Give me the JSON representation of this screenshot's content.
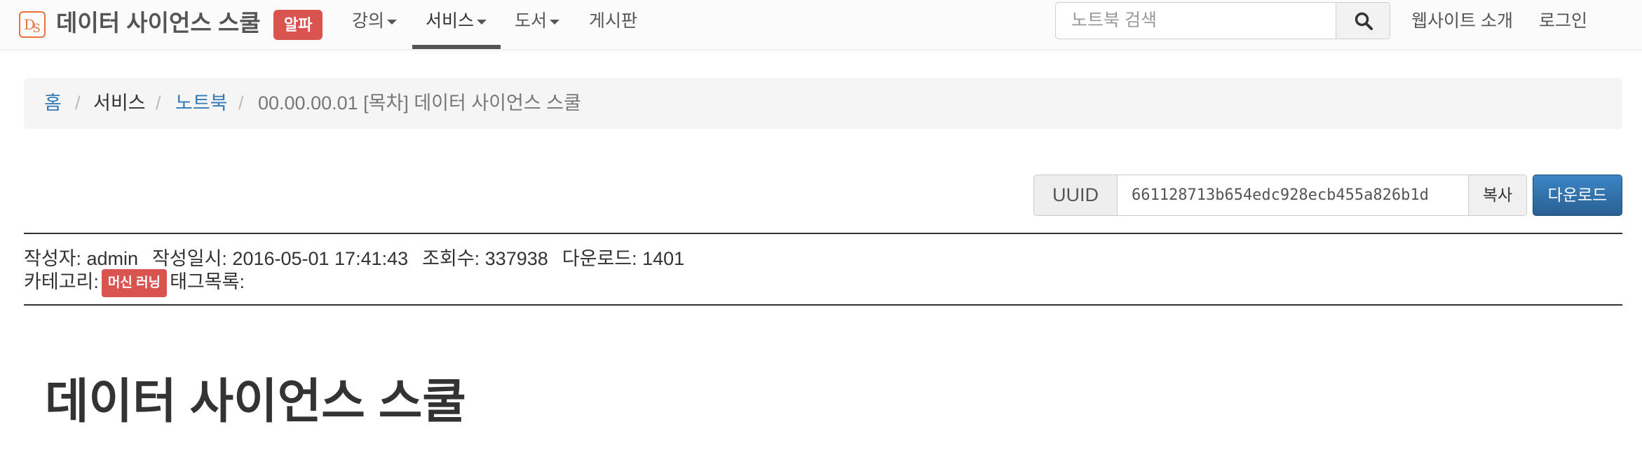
{
  "navbar": {
    "logo_text": "DS",
    "brand": "데이터 사이언스 스쿨",
    "badge": "알파",
    "menu": [
      {
        "label": "강의",
        "dropdown": true
      },
      {
        "label": "서비스",
        "dropdown": true,
        "active": true
      },
      {
        "label": "도서",
        "dropdown": true
      },
      {
        "label": "게시판",
        "dropdown": false
      }
    ],
    "search_placeholder": "노트북 검색",
    "search_icon": "search-icon",
    "right_links": [
      "웹사이트 소개",
      "로그인"
    ]
  },
  "breadcrumb": {
    "items": [
      "홈",
      "서비스",
      "노트북",
      "00.00.00.01 [목차] 데이터 사이언스 스쿨"
    ],
    "separator": "/"
  },
  "uuid": {
    "label": "UUID",
    "value": "661128713b654edc928ecb455a826b1d",
    "copy_label": "복사",
    "download_label": "다운로드"
  },
  "meta": {
    "author": "작성자: admin",
    "created": "작성일시: 2016-05-01 17:41:43",
    "views": "조회수: 337938",
    "downloads": "다운로드: 1401",
    "category_label": "카테고리:",
    "category": "머신 러닝",
    "tags_label": "태그목록:"
  },
  "content": {
    "title": "데이터 사이언스 스쿨"
  },
  "colors": {
    "accent_red": "#d9534f",
    "link_blue": "#337ab7",
    "primary_button": "#286090",
    "logo_orange": "#e8743b"
  }
}
